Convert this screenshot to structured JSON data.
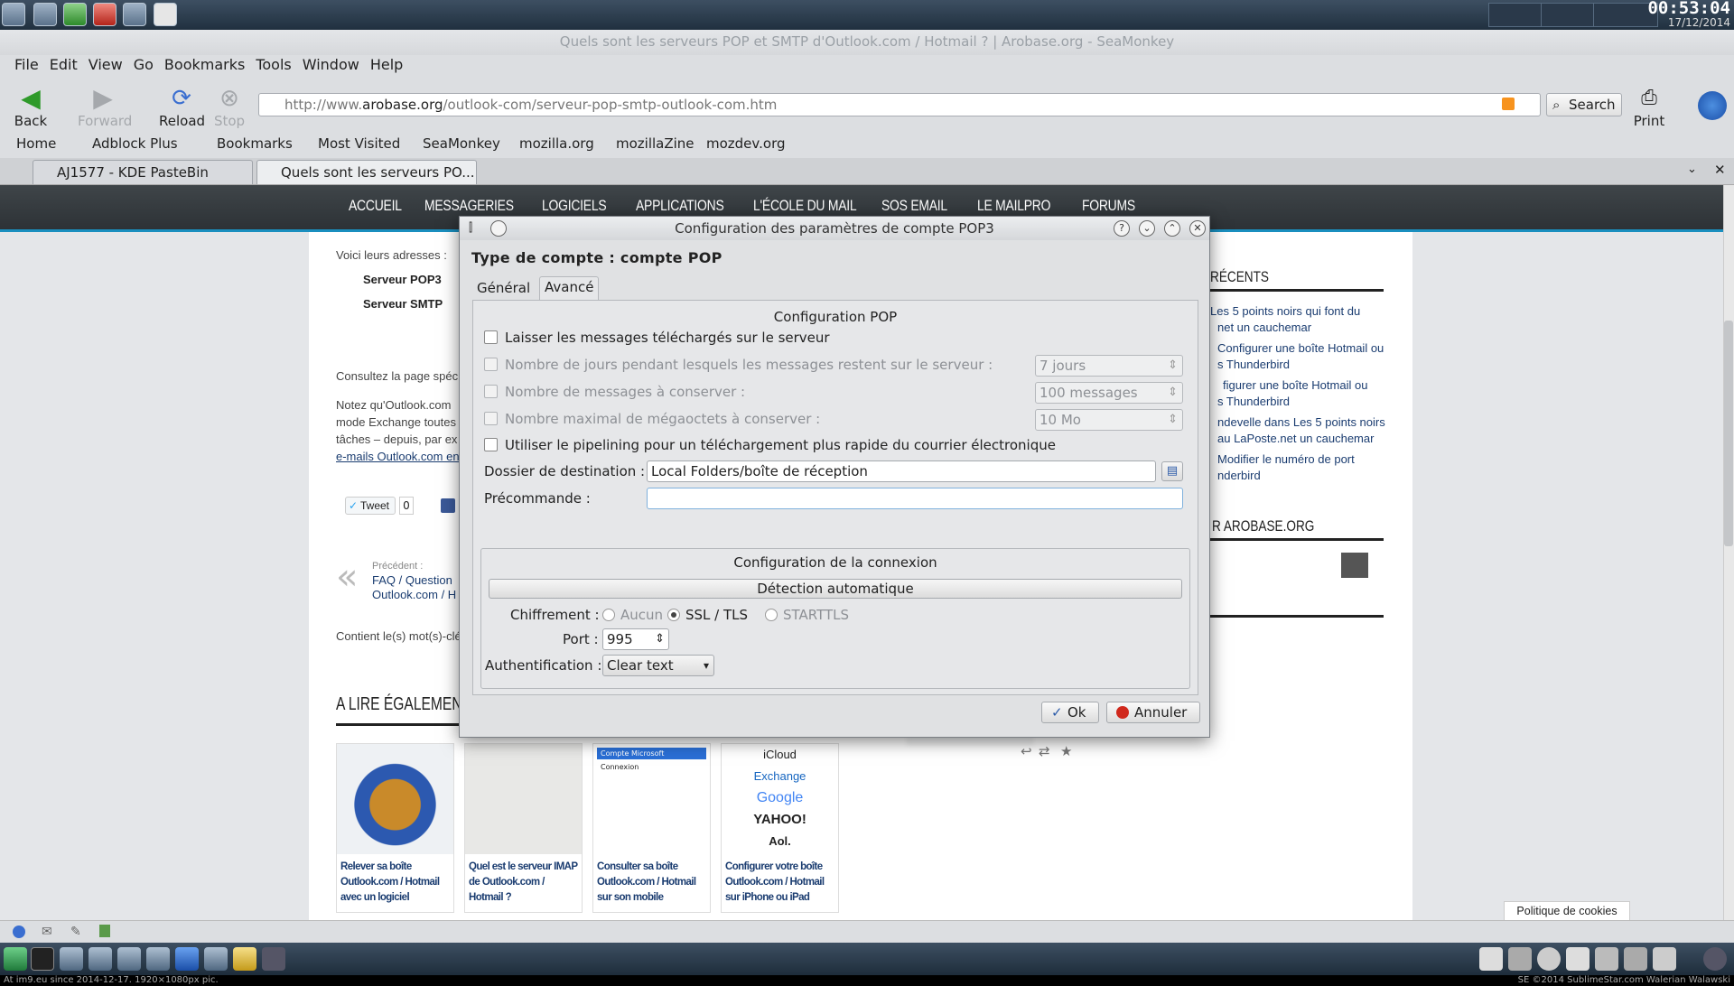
{
  "panel": {
    "time": "00:53:04",
    "date": "17/12/2014"
  },
  "window_title": "Quels sont les serveurs POP et SMTP d'Outlook.com / Hotmail ? | Arobase.org - SeaMonkey",
  "menu": [
    "File",
    "Edit",
    "View",
    "Go",
    "Bookmarks",
    "Tools",
    "Window",
    "Help"
  ],
  "nav": {
    "back": "Back",
    "forward": "Forward",
    "reload": "Reload",
    "stop": "Stop",
    "print": "Print",
    "search": "Search"
  },
  "url": {
    "scheme": "http://www.",
    "domain": "arobase.org",
    "path": "/outlook-com/serveur-pop-smtp-outlook-com.htm"
  },
  "bookmarks": [
    "Home",
    "Adblock Plus",
    "Bookmarks",
    "Most Visited",
    "SeaMonkey",
    "mozilla.org",
    "mozillaZine",
    "mozdev.org"
  ],
  "tabs": [
    "AJ1577 - KDE PasteBin",
    "Quels sont les serveurs PO..."
  ],
  "site_nav": [
    "ACCUEIL",
    "MESSAGERIES",
    "LOGICIELS",
    "APPLICATIONS",
    "L'ÉCOLE DU MAIL",
    "SOS EMAIL",
    "LE MAILPRO",
    "FORUMS"
  ],
  "page": {
    "voici": "Voici leurs adresses :",
    "pop_label": "Serveur POP3",
    "smtp_label": "Serveur SMTP",
    "consultez": "Consultez la page spéc",
    "notez": "Notez qu'Outlook.com",
    "mode": "mode Exchange toutes",
    "taches": "tâches – depuis, par ex",
    "emails": "e-mails Outlook.com en",
    "tweet": "Tweet",
    "tweet_count": "0",
    "precedent": "Précédent :",
    "prev1": "FAQ / Question",
    "prev2": "Outlook.com / H",
    "contient": "Contient le(s) mot(s)-clé",
    "a_lire": "A LIRE ÉGALEMENT",
    "recents": "RÉCENTS",
    "arobase": "R AROBASE.ORG",
    "sidebar_links": [
      "Les 5 points noirs qui font du",
      "net un cauchemar",
      "Configurer une boîte Hotmail ou",
      "s Thunderbird",
      "figurer une boîte Hotmail ou",
      "s Thunderbird",
      "ndevelle dans Les 5 points noirs",
      "au LaPoste.net un cauchemar",
      "Modifier le numéro de port",
      "nderbird"
    ],
    "thumbs": [
      {
        "caption": "Relever sa boîte Outlook.com / Hotmail avec un logiciel"
      },
      {
        "caption": "Quel est le serveur IMAP de Outlook.com / Hotmail ?"
      },
      {
        "caption": "Consulter sa boîte Outlook.com / Hotmail sur son mobile"
      },
      {
        "caption": "Configurer votre boîte Outlook.com / Hotmail sur iPhone ou iPad"
      }
    ],
    "thumb3_lines": [
      "Compte Microsoft",
      "Connexion"
    ],
    "thumb4_logos": [
      "iCloud",
      "Exchange",
      "Google",
      "YAHOO!",
      "Aol."
    ],
    "cookie": "Politique de cookies"
  },
  "dialog": {
    "title": "Configuration des paramètres de compte POP3",
    "heading": "Type de compte : compte POP",
    "tab_general": "Général",
    "tab_advanced": "Avancé",
    "pop_section": "Configuration POP",
    "leave_on_server": "Laisser les messages téléchargés sur le serveur",
    "days_label": "Nombre de jours pendant lesquels les messages restent sur le serveur :",
    "days_value": "7 jours",
    "count_label": "Nombre de messages à conserver :",
    "count_value": "100 messages",
    "mb_label": "Nombre maximal de mégaoctets à conserver :",
    "mb_value": "10 Mo",
    "pipelining": "Utiliser le pipelining pour un téléchargement plus rapide du courrier électronique",
    "dest_label": "Dossier de destination :",
    "dest_value": "Local Folders/boîte de réception",
    "precommand_label": "Précommande :",
    "precommand_value": "",
    "conn_section": "Configuration de la connexion",
    "autodetect": "Détection automatique",
    "encryption_label": "Chiffrement :",
    "enc_none": "Aucun",
    "enc_ssl": "SSL / TLS",
    "enc_starttls": "STARTTLS",
    "port_label": "Port :",
    "port_value": "995",
    "auth_label": "Authentification :",
    "auth_value": "Clear text",
    "ok": "Ok",
    "cancel": "Annuler"
  },
  "footer": {
    "left": "At im9.eu since 2014-12-17. 1920×1080px pic.",
    "right": "SE ©2014 SublimeStar.com Walerian Walawski"
  }
}
